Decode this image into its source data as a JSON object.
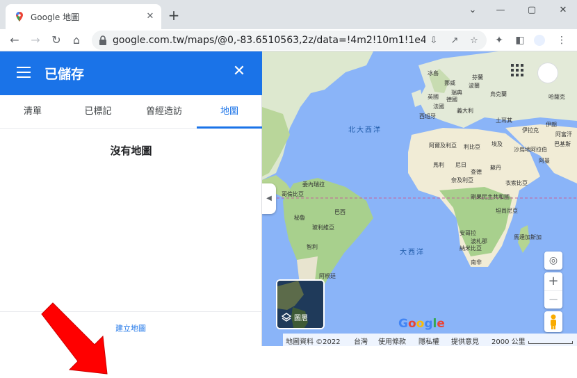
{
  "browser": {
    "tab_title": "Google 地圖",
    "tab_close": "✕",
    "new_tab": "+",
    "url": "google.com.tw/maps/@0,-83.6510563,2z/data=!4m2!10m1!1e4?hl=zh-..."
  },
  "panel": {
    "title": "已儲存",
    "close": "✕",
    "tabs": [
      "清單",
      "已標記",
      "曾經造訪",
      "地圖"
    ],
    "active_tab": 3,
    "empty_title": "沒有地圖",
    "create_map": "建立地圖"
  },
  "map": {
    "ocean_labels": [
      "北大西洋",
      "大西洋"
    ],
    "place_labels": [
      "冰島",
      "挪威",
      "瑞典",
      "芬蘭",
      "波蘭",
      "烏克蘭",
      "哈薩克",
      "英國",
      "德國",
      "法國",
      "西班牙",
      "義大利",
      "土耳其",
      "伊拉克",
      "伊朗",
      "阿富汗",
      "阿爾及利亞",
      "利比亞",
      "埃及",
      "沙烏地阿拉伯",
      "馬利",
      "尼日",
      "蘇丹",
      "查德",
      "奈及利亞",
      "衣索比亞",
      "委內瑞拉",
      "哥倫比亞",
      "秘魯",
      "巴西",
      "玻利維亞",
      "智利",
      "阿根廷",
      "剛果民主共和國",
      "坦尚尼亞",
      "安哥拉",
      "納米比亞",
      "波札那",
      "南非",
      "馬達加斯加",
      "巴基斯",
      "阿曼"
    ],
    "layers_label": "圖層",
    "google_logo": [
      "G",
      "o",
      "o",
      "g",
      "l",
      "e"
    ],
    "google_colors": [
      "#4285f4",
      "#ea4335",
      "#fbbc05",
      "#4285f4",
      "#34a853",
      "#ea4335"
    ],
    "attribution": {
      "data": "地圖資料 ©2022",
      "region": "台灣",
      "terms": "使用條款",
      "privacy": "隱私權",
      "feedback": "提供意見",
      "scale": "2000 公里"
    },
    "zoom_in": "+",
    "zoom_out": "−"
  },
  "colors": {
    "brand_blue": "#1a73e8",
    "ocean": "#8ab4f8",
    "land": "#e8e6df",
    "forest": "#a8d08d",
    "desert": "#f1ecd6"
  }
}
